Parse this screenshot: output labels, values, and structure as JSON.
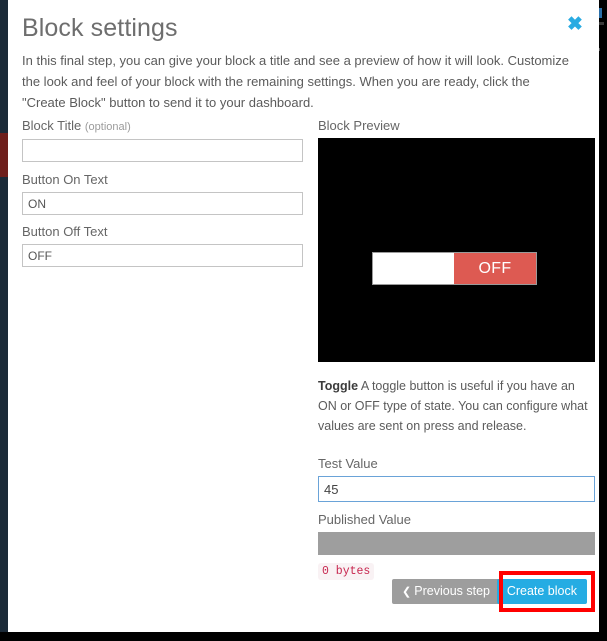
{
  "modal": {
    "title": "Block settings",
    "close_icon": "close-icon",
    "close_glyph": "✖",
    "intro": "In this final step, you can give your block a title and see a preview of how it will look. Customize the look and feel of your block with the remaining settings. When you are ready, click the \"Create Block\" button to send it to your dashboard."
  },
  "form": {
    "block_title": {
      "label": "Block Title",
      "optional_note": "(optional)",
      "value": "",
      "placeholder": ""
    },
    "button_on_text": {
      "label": "Button On Text",
      "value": "ON",
      "placeholder": ""
    },
    "button_off_text": {
      "label": "Button Off Text",
      "value": "OFF",
      "placeholder": ""
    }
  },
  "preview": {
    "label": "Block Preview",
    "toggle_state_label": "OFF",
    "background_color": "#000000",
    "active_color": "#dd5a52"
  },
  "description": {
    "type_name": "Toggle",
    "text": " A toggle button is useful if you have an ON or OFF type of state. You can configure what values are sent on press and release."
  },
  "test": {
    "label": "Test Value",
    "value": "45",
    "placeholder": ""
  },
  "published": {
    "label": "Published Value",
    "value": "",
    "bytes_label": "0 bytes"
  },
  "footer": {
    "previous_chevron": "❮",
    "previous_label": "Previous step",
    "create_label": "Create block",
    "create_color": "#25ace3",
    "annotation_color": "#ff0000"
  },
  "background": {
    "chip_a": "▐",
    "chip_b": "█"
  }
}
